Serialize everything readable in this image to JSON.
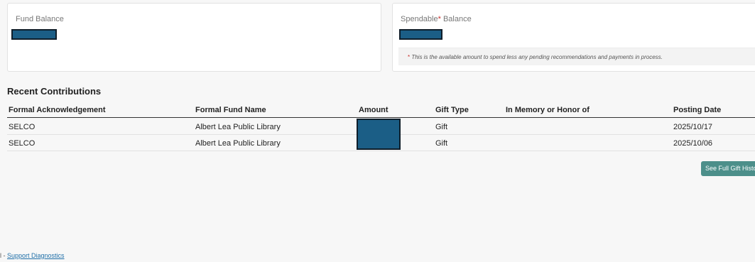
{
  "cards": {
    "fund_balance": {
      "label": "Fund Balance"
    },
    "spendable_balance": {
      "label": "Spendable",
      "asterisk": "*",
      "label_suffix": " Balance",
      "note_star": "*",
      "note": " This is the available amount to spend less any pending recommendations and payments in process."
    }
  },
  "contributions": {
    "title": "Recent Contributions",
    "columns": [
      "Formal Acknowledgement",
      "Formal Fund Name",
      "Amount",
      "Gift Type",
      "In Memory or Honor of",
      "Posting Date"
    ],
    "rows": [
      {
        "acknowledgement": "SELCO",
        "fund_name": "Albert Lea Public Library",
        "gift_type": "Gift",
        "memory_honor": "",
        "posting_date": "2025/10/17"
      },
      {
        "acknowledgement": "SELCO",
        "fund_name": "Albert Lea Public Library",
        "gift_type": "Gift",
        "memory_honor": "",
        "posting_date": "2025/10/06"
      }
    ],
    "history_button": "See Full Gift History"
  },
  "footer": {
    "prefix": "l - ",
    "link": "Support Diagnostics"
  },
  "colors": {
    "redaction": "#1b5e86",
    "button": "#4c8f8a",
    "required": "#c9302c"
  }
}
